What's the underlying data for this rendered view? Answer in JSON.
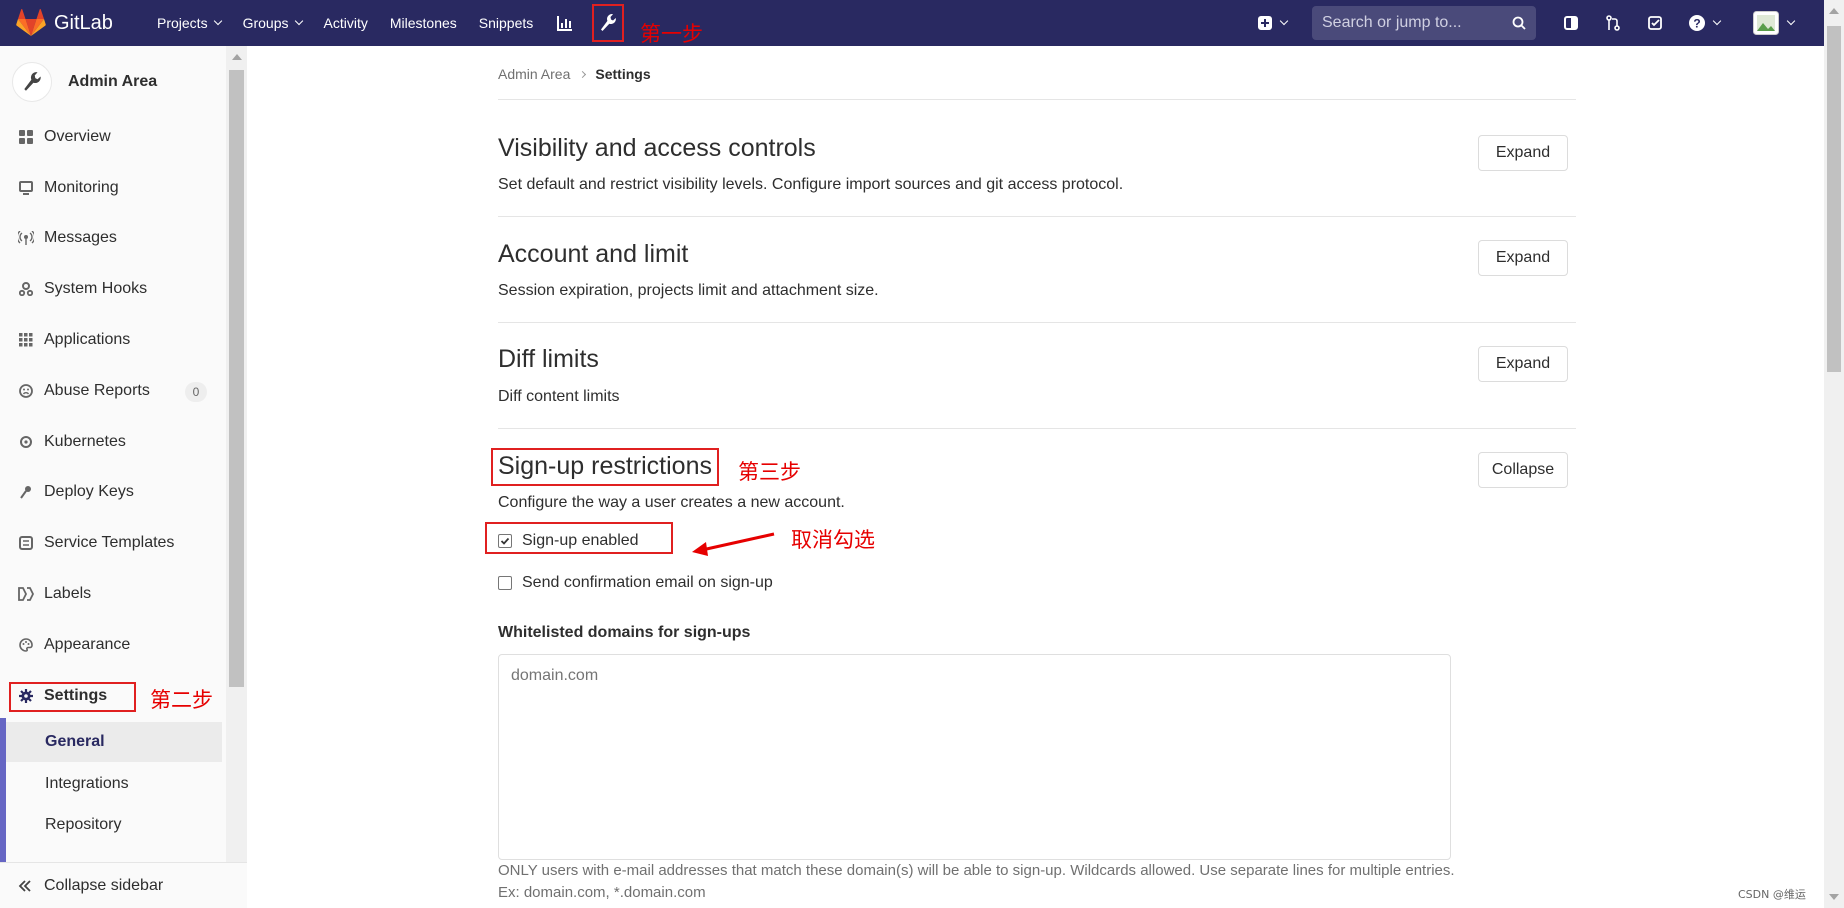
{
  "navbar": {
    "brand": "GitLab",
    "links": [
      {
        "label": "Projects",
        "dropdown": true
      },
      {
        "label": "Groups",
        "dropdown": true
      },
      {
        "label": "Activity",
        "dropdown": false
      },
      {
        "label": "Milestones",
        "dropdown": false
      },
      {
        "label": "Snippets",
        "dropdown": false
      }
    ],
    "search_placeholder": "Search or jump to...",
    "background_color": "#292961",
    "icons": [
      "chart-icon",
      "admin-wrench-icon",
      "plus-square-icon",
      "sidebar-icon",
      "merge-request-icon",
      "todo-check-icon",
      "help-icon",
      "avatar"
    ]
  },
  "annotations": {
    "step1": "第一步",
    "step2": "第二步",
    "step3": "第三步",
    "uncheck": "取消勾选",
    "color": "#e60000"
  },
  "sidebar": {
    "context_title": "Admin Area",
    "items": [
      {
        "label": "Overview",
        "icon": "overview-icon"
      },
      {
        "label": "Monitoring",
        "icon": "monitor-icon"
      },
      {
        "label": "Messages",
        "icon": "broadcast-icon"
      },
      {
        "label": "System Hooks",
        "icon": "hook-icon"
      },
      {
        "label": "Applications",
        "icon": "apps-grid-icon"
      },
      {
        "label": "Abuse Reports",
        "icon": "abuse-icon",
        "badge": "0"
      },
      {
        "label": "Kubernetes",
        "icon": "kubernetes-icon"
      },
      {
        "label": "Deploy Keys",
        "icon": "key-icon"
      },
      {
        "label": "Service Templates",
        "icon": "template-icon"
      },
      {
        "label": "Labels",
        "icon": "labels-icon"
      },
      {
        "label": "Appearance",
        "icon": "palette-icon"
      },
      {
        "label": "Settings",
        "icon": "gear-icon",
        "active": true
      }
    ],
    "sub_items": [
      "General",
      "Integrations",
      "Repository"
    ],
    "active_sub": "General",
    "collapse_label": "Collapse sidebar",
    "accent_color": "#6666c4"
  },
  "breadcrumb": {
    "parent": "Admin Area",
    "current": "Settings"
  },
  "sections": [
    {
      "title": "Visibility and access controls",
      "description": "Set default and restrict visibility levels. Configure import sources and git access protocol.",
      "button": "Expand"
    },
    {
      "title": "Account and limit",
      "description": "Session expiration, projects limit and attachment size.",
      "button": "Expand"
    },
    {
      "title": "Diff limits",
      "description": "Diff content limits",
      "button": "Expand"
    },
    {
      "title": "Sign-up restrictions",
      "description": "Configure the way a user creates a new account.",
      "button": "Collapse"
    }
  ],
  "signup": {
    "checkboxes": [
      {
        "label": "Sign-up enabled",
        "checked": true
      },
      {
        "label": "Send confirmation email on sign-up",
        "checked": false
      }
    ],
    "whitelist_label": "Whitelisted domains for sign-ups",
    "whitelist_placeholder": "domain.com",
    "help_text": "ONLY users with e-mail addresses that match these domain(s) will be able to sign-up. Wildcards allowed. Use separate lines for multiple entries. Ex: domain.com, *.domain.com"
  },
  "watermark": "CSDN @维运"
}
